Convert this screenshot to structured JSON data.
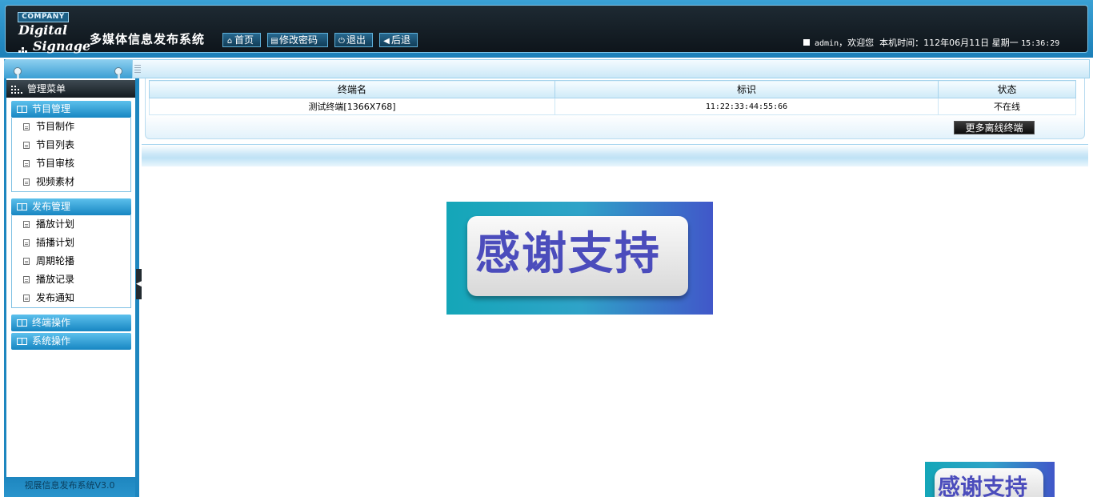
{
  "header": {
    "company": "COMPANY",
    "logo_line1": "Digital",
    "logo_line2": "Signage",
    "system_title": "多媒体信息发布系统",
    "buttons": {
      "home": "首页",
      "change_password": "修改密码",
      "logout": "退出",
      "back": "后退"
    },
    "user": "admin",
    "welcome": "，欢迎您",
    "time_label": "本机时间：",
    "date": "112年06月11日",
    "weekday": "星期一",
    "time": "15:36:29"
  },
  "sidebar": {
    "title": "管理菜单",
    "groups": [
      {
        "label": "节目管理",
        "items": [
          "节目制作",
          "节目列表",
          "节目审核",
          "视频素材"
        ]
      },
      {
        "label": "发布管理",
        "items": [
          "播放计划",
          "插播计划",
          "周期轮播",
          "播放记录",
          "发布通知"
        ]
      },
      {
        "label": "终端操作",
        "items": []
      },
      {
        "label": "系统操作",
        "items": []
      }
    ],
    "version": "视展信息发布系统V3.0"
  },
  "terminal_table": {
    "columns": [
      "终端名",
      "标识",
      "状态"
    ],
    "rows": [
      {
        "name": "测试终端[1366X768]",
        "id": "11:22:33:44:55:66",
        "status": "不在线"
      }
    ],
    "more_button": "更多离线终端"
  },
  "banner": {
    "text": "感谢支持"
  },
  "colors": {
    "header_bg": "#121a20",
    "accent_blue": "#1d86bf",
    "banner_text": "#4b4cbc"
  },
  "icons": {
    "home": "home-icon",
    "change_password": "document-icon",
    "logout": "power-icon",
    "back": "back-arrow-icon"
  }
}
